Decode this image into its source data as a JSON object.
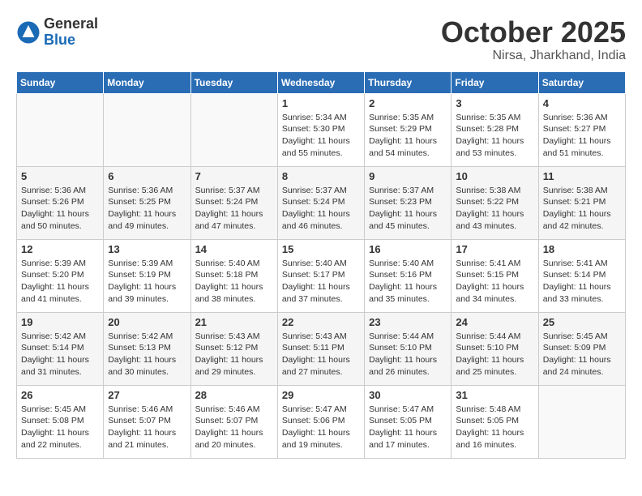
{
  "header": {
    "logo_general": "General",
    "logo_blue": "Blue",
    "month_title": "October 2025",
    "location": "Nirsa, Jharkhand, India"
  },
  "days_of_week": [
    "Sunday",
    "Monday",
    "Tuesday",
    "Wednesday",
    "Thursday",
    "Friday",
    "Saturday"
  ],
  "weeks": [
    [
      {
        "num": "",
        "sunrise": "",
        "sunset": "",
        "daylight": ""
      },
      {
        "num": "",
        "sunrise": "",
        "sunset": "",
        "daylight": ""
      },
      {
        "num": "",
        "sunrise": "",
        "sunset": "",
        "daylight": ""
      },
      {
        "num": "1",
        "sunrise": "Sunrise: 5:34 AM",
        "sunset": "Sunset: 5:30 PM",
        "daylight": "Daylight: 11 hours and 55 minutes."
      },
      {
        "num": "2",
        "sunrise": "Sunrise: 5:35 AM",
        "sunset": "Sunset: 5:29 PM",
        "daylight": "Daylight: 11 hours and 54 minutes."
      },
      {
        "num": "3",
        "sunrise": "Sunrise: 5:35 AM",
        "sunset": "Sunset: 5:28 PM",
        "daylight": "Daylight: 11 hours and 53 minutes."
      },
      {
        "num": "4",
        "sunrise": "Sunrise: 5:36 AM",
        "sunset": "Sunset: 5:27 PM",
        "daylight": "Daylight: 11 hours and 51 minutes."
      }
    ],
    [
      {
        "num": "5",
        "sunrise": "Sunrise: 5:36 AM",
        "sunset": "Sunset: 5:26 PM",
        "daylight": "Daylight: 11 hours and 50 minutes."
      },
      {
        "num": "6",
        "sunrise": "Sunrise: 5:36 AM",
        "sunset": "Sunset: 5:25 PM",
        "daylight": "Daylight: 11 hours and 49 minutes."
      },
      {
        "num": "7",
        "sunrise": "Sunrise: 5:37 AM",
        "sunset": "Sunset: 5:24 PM",
        "daylight": "Daylight: 11 hours and 47 minutes."
      },
      {
        "num": "8",
        "sunrise": "Sunrise: 5:37 AM",
        "sunset": "Sunset: 5:24 PM",
        "daylight": "Daylight: 11 hours and 46 minutes."
      },
      {
        "num": "9",
        "sunrise": "Sunrise: 5:37 AM",
        "sunset": "Sunset: 5:23 PM",
        "daylight": "Daylight: 11 hours and 45 minutes."
      },
      {
        "num": "10",
        "sunrise": "Sunrise: 5:38 AM",
        "sunset": "Sunset: 5:22 PM",
        "daylight": "Daylight: 11 hours and 43 minutes."
      },
      {
        "num": "11",
        "sunrise": "Sunrise: 5:38 AM",
        "sunset": "Sunset: 5:21 PM",
        "daylight": "Daylight: 11 hours and 42 minutes."
      }
    ],
    [
      {
        "num": "12",
        "sunrise": "Sunrise: 5:39 AM",
        "sunset": "Sunset: 5:20 PM",
        "daylight": "Daylight: 11 hours and 41 minutes."
      },
      {
        "num": "13",
        "sunrise": "Sunrise: 5:39 AM",
        "sunset": "Sunset: 5:19 PM",
        "daylight": "Daylight: 11 hours and 39 minutes."
      },
      {
        "num": "14",
        "sunrise": "Sunrise: 5:40 AM",
        "sunset": "Sunset: 5:18 PM",
        "daylight": "Daylight: 11 hours and 38 minutes."
      },
      {
        "num": "15",
        "sunrise": "Sunrise: 5:40 AM",
        "sunset": "Sunset: 5:17 PM",
        "daylight": "Daylight: 11 hours and 37 minutes."
      },
      {
        "num": "16",
        "sunrise": "Sunrise: 5:40 AM",
        "sunset": "Sunset: 5:16 PM",
        "daylight": "Daylight: 11 hours and 35 minutes."
      },
      {
        "num": "17",
        "sunrise": "Sunrise: 5:41 AM",
        "sunset": "Sunset: 5:15 PM",
        "daylight": "Daylight: 11 hours and 34 minutes."
      },
      {
        "num": "18",
        "sunrise": "Sunrise: 5:41 AM",
        "sunset": "Sunset: 5:14 PM",
        "daylight": "Daylight: 11 hours and 33 minutes."
      }
    ],
    [
      {
        "num": "19",
        "sunrise": "Sunrise: 5:42 AM",
        "sunset": "Sunset: 5:14 PM",
        "daylight": "Daylight: 11 hours and 31 minutes."
      },
      {
        "num": "20",
        "sunrise": "Sunrise: 5:42 AM",
        "sunset": "Sunset: 5:13 PM",
        "daylight": "Daylight: 11 hours and 30 minutes."
      },
      {
        "num": "21",
        "sunrise": "Sunrise: 5:43 AM",
        "sunset": "Sunset: 5:12 PM",
        "daylight": "Daylight: 11 hours and 29 minutes."
      },
      {
        "num": "22",
        "sunrise": "Sunrise: 5:43 AM",
        "sunset": "Sunset: 5:11 PM",
        "daylight": "Daylight: 11 hours and 27 minutes."
      },
      {
        "num": "23",
        "sunrise": "Sunrise: 5:44 AM",
        "sunset": "Sunset: 5:10 PM",
        "daylight": "Daylight: 11 hours and 26 minutes."
      },
      {
        "num": "24",
        "sunrise": "Sunrise: 5:44 AM",
        "sunset": "Sunset: 5:10 PM",
        "daylight": "Daylight: 11 hours and 25 minutes."
      },
      {
        "num": "25",
        "sunrise": "Sunrise: 5:45 AM",
        "sunset": "Sunset: 5:09 PM",
        "daylight": "Daylight: 11 hours and 24 minutes."
      }
    ],
    [
      {
        "num": "26",
        "sunrise": "Sunrise: 5:45 AM",
        "sunset": "Sunset: 5:08 PM",
        "daylight": "Daylight: 11 hours and 22 minutes."
      },
      {
        "num": "27",
        "sunrise": "Sunrise: 5:46 AM",
        "sunset": "Sunset: 5:07 PM",
        "daylight": "Daylight: 11 hours and 21 minutes."
      },
      {
        "num": "28",
        "sunrise": "Sunrise: 5:46 AM",
        "sunset": "Sunset: 5:07 PM",
        "daylight": "Daylight: 11 hours and 20 minutes."
      },
      {
        "num": "29",
        "sunrise": "Sunrise: 5:47 AM",
        "sunset": "Sunset: 5:06 PM",
        "daylight": "Daylight: 11 hours and 19 minutes."
      },
      {
        "num": "30",
        "sunrise": "Sunrise: 5:47 AM",
        "sunset": "Sunset: 5:05 PM",
        "daylight": "Daylight: 11 hours and 17 minutes."
      },
      {
        "num": "31",
        "sunrise": "Sunrise: 5:48 AM",
        "sunset": "Sunset: 5:05 PM",
        "daylight": "Daylight: 11 hours and 16 minutes."
      },
      {
        "num": "",
        "sunrise": "",
        "sunset": "",
        "daylight": ""
      }
    ]
  ]
}
